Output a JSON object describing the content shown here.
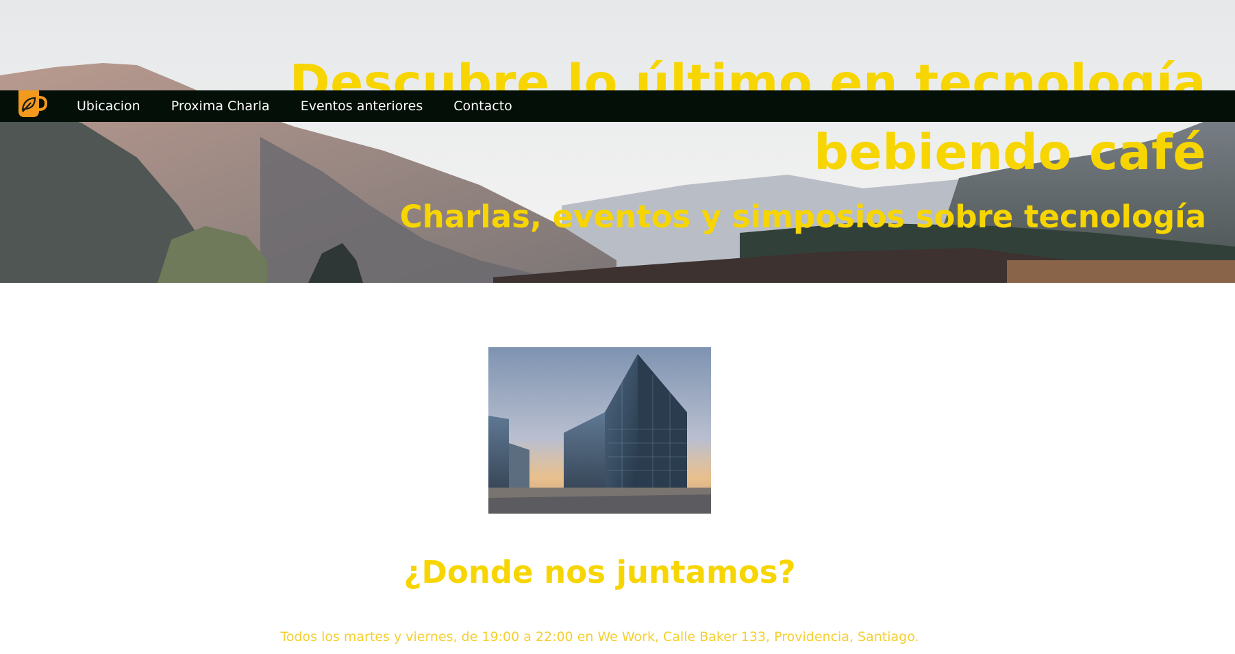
{
  "hero": {
    "title": "Descubre lo último en tecnología bebiendo café",
    "subtitle": "Charlas, eventos y simposios sobre tecnología",
    "background_image": "mountain-valley-photo"
  },
  "navbar": {
    "logo_icon": "coffee-mug-leaf-icon",
    "links": [
      "Ubicacion",
      "Proxima Charla",
      "Eventos anteriores",
      "Contacto"
    ]
  },
  "location_section": {
    "image": "glass-office-building-photo",
    "heading": "¿Donde nos juntamos?",
    "text": "Todos los martes y viernes, de 19:00 a 22:00 en We Work, Calle Baker 133, Providencia, Santiago."
  },
  "colors": {
    "accent_yellow": "#f7d500",
    "navbar_bg": "#030f07",
    "logo_orange": "#f39a1e"
  }
}
